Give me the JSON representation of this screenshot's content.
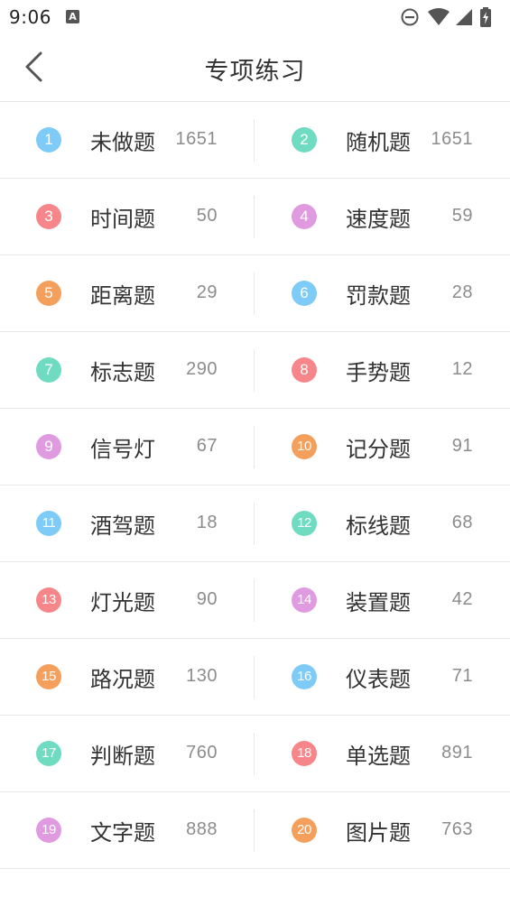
{
  "status_bar": {
    "time": "9:06",
    "notification_icon": "A",
    "icons": [
      "do-not-disturb-icon",
      "wifi-icon",
      "signal-icon",
      "battery-charging-icon"
    ]
  },
  "header": {
    "title": "专项练习",
    "back_icon": "chevron-left-icon"
  },
  "colors": {
    "blue": "#7ecbf7",
    "green": "#6fdcc2",
    "red": "#f7868a",
    "purple": "#df9ae0",
    "orange": "#f4a05c"
  },
  "items": [
    {
      "num": "1",
      "label": "未做题",
      "count": "1651",
      "color": "#7ecbf7"
    },
    {
      "num": "2",
      "label": "随机题",
      "count": "1651",
      "color": "#6fdcc2"
    },
    {
      "num": "3",
      "label": "时间题",
      "count": "50",
      "color": "#f7868a"
    },
    {
      "num": "4",
      "label": "速度题",
      "count": "59",
      "color": "#df9ae0"
    },
    {
      "num": "5",
      "label": "距离题",
      "count": "29",
      "color": "#f4a05c"
    },
    {
      "num": "6",
      "label": "罚款题",
      "count": "28",
      "color": "#7ecbf7"
    },
    {
      "num": "7",
      "label": "标志题",
      "count": "290",
      "color": "#6fdcc2"
    },
    {
      "num": "8",
      "label": "手势题",
      "count": "12",
      "color": "#f7868a"
    },
    {
      "num": "9",
      "label": "信号灯",
      "count": "67",
      "color": "#df9ae0"
    },
    {
      "num": "10",
      "label": "记分题",
      "count": "91",
      "color": "#f4a05c"
    },
    {
      "num": "11",
      "label": "酒驾题",
      "count": "18",
      "color": "#7ecbf7"
    },
    {
      "num": "12",
      "label": "标线题",
      "count": "68",
      "color": "#6fdcc2"
    },
    {
      "num": "13",
      "label": "灯光题",
      "count": "90",
      "color": "#f7868a"
    },
    {
      "num": "14",
      "label": "装置题",
      "count": "42",
      "color": "#df9ae0"
    },
    {
      "num": "15",
      "label": "路况题",
      "count": "130",
      "color": "#f4a05c"
    },
    {
      "num": "16",
      "label": "仪表题",
      "count": "71",
      "color": "#7ecbf7"
    },
    {
      "num": "17",
      "label": "判断题",
      "count": "760",
      "color": "#6fdcc2"
    },
    {
      "num": "18",
      "label": "单选题",
      "count": "891",
      "color": "#f7868a"
    },
    {
      "num": "19",
      "label": "文字题",
      "count": "888",
      "color": "#df9ae0"
    },
    {
      "num": "20",
      "label": "图片题",
      "count": "763",
      "color": "#f4a05c"
    }
  ]
}
